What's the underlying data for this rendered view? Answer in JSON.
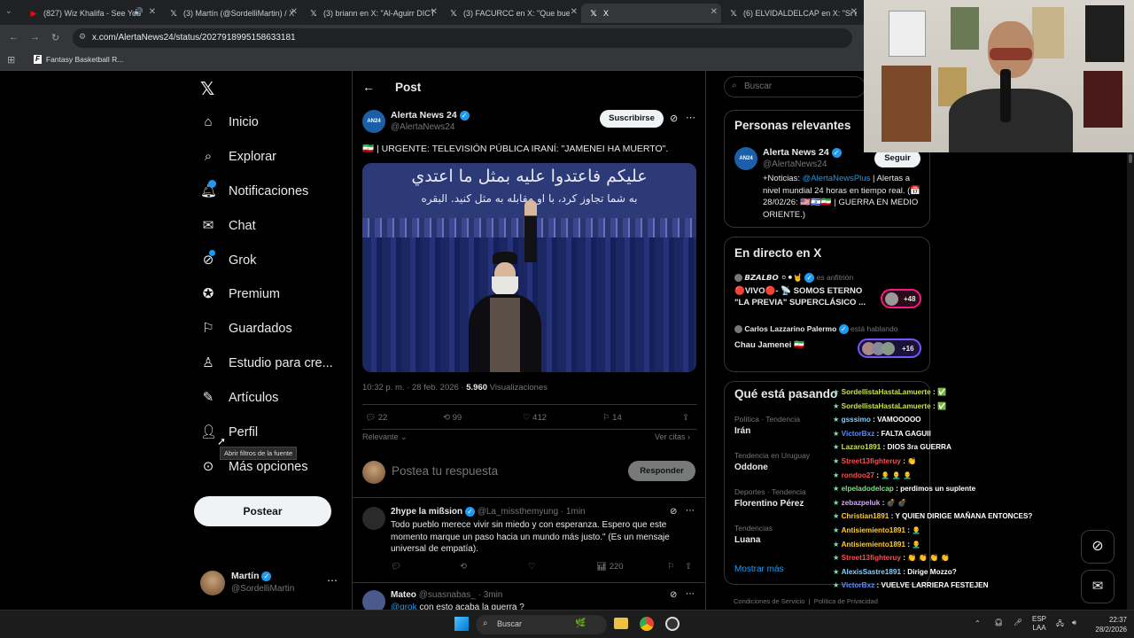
{
  "browser": {
    "tabs": [
      {
        "icon": "youtube-icon",
        "label": "(827) Wiz Khalifa - See You"
      },
      {
        "icon": "x-logo-icon",
        "label": "(3) Martín (@SordelliMartin) / X"
      },
      {
        "icon": "x-logo-icon",
        "label": "(3) briann en X: \"Al-Aguirr DICT"
      },
      {
        "icon": "x-logo-icon",
        "label": "(3) FACURCC en X: \"Que buen"
      },
      {
        "icon": "x-logo-icon",
        "label": "X"
      },
      {
        "icon": "x-logo-icon",
        "label": "(6) ELVIDALDELCAP en X: \"Si en"
      }
    ],
    "url": "x.com/AlertaNews24/status/2027918995158633181",
    "bookmark": "Fantasy Basketball R..."
  },
  "sidebar": {
    "items": [
      {
        "label": "Inicio",
        "icon": "home-icon"
      },
      {
        "label": "Explorar",
        "icon": "search-icon"
      },
      {
        "label": "Notificaciones",
        "icon": "bell-icon"
      },
      {
        "label": "Chat",
        "icon": "mail-icon"
      },
      {
        "label": "Grok",
        "icon": "grok-icon"
      },
      {
        "label": "Premium",
        "icon": "verified-icon"
      },
      {
        "label": "Guardados",
        "icon": "bookmark-icon"
      },
      {
        "label": "Estudio para cre...",
        "icon": "studio-icon"
      },
      {
        "label": "Artículos",
        "icon": "article-icon"
      },
      {
        "label": "Perfil",
        "icon": "person-icon"
      },
      {
        "label": "Más opciones",
        "icon": "more-icon"
      }
    ],
    "tooltip": "Abrir filtros de la fuente",
    "post_button": "Postear",
    "account": {
      "name": "Martín",
      "handle": "@SordelliMartin"
    }
  },
  "post": {
    "header": "Post",
    "author": "Alerta News 24",
    "handle": "@AlertaNews24",
    "subscribe": "Suscribirse",
    "text": "🇮🇷 | URGENTE: TELEVISIÓN PÚBLICA IRANÍ: \"JAMENEI HA MUERTO\".",
    "image_text_1": "عليكم فاعتدوا عليه بمثل ما اعتدي",
    "image_text_2": "به شما تجاوز كرد، با او مقابله به مثل كنيد. البقره",
    "time": "10:32 p. m. · 28 feb. 2026 ·",
    "views_count": "5.960",
    "views_label": "Visualizaciones",
    "replies": "22",
    "reposts": "99",
    "likes": "412",
    "bookmarks": "14",
    "relevant": "Relevante",
    "quotes": "Ver citas",
    "reply_placeholder": "Postea tu respuesta",
    "reply_button": "Responder"
  },
  "replies": [
    {
      "name": "2hype la mißsion",
      "handle": "@La_missthemyung",
      "time": "1min",
      "text": "Todo pueblo merece vivir sin miedo y con esperanza. Espero que este momento marque un paso hacia un mundo más justo.\" (Es un mensaje universal de empatía).",
      "views": "220"
    },
    {
      "name": "Mateo",
      "handle": "@suasnabas_",
      "time": "3min",
      "mention": "@grok",
      "text": "con esto acaba la guerra ?"
    }
  ],
  "right": {
    "search_placeholder": "Buscar",
    "relevant_title": "Personas relevantes",
    "person": {
      "name": "Alerta News 24",
      "handle": "@AlertaNews24",
      "follow": "Seguir",
      "bio_1": "+Noticias: ",
      "bio_link": "@AlertaNewsPlus",
      "bio_2": " | Alertas a nivel mundial 24 horas en tiempo real. (📅 28/02/26: 🇺🇸🇮🇱🇮🇷 | GUERRA EN MEDIO ORIENTE.)"
    },
    "live_title": "En directo en X",
    "live": [
      {
        "host": "𝘽𝙕𝘼𝙇𝘽𝙊 ⚪⚫🤘",
        "role": "es anfitrión",
        "title": "🔴VIVO🔴- 📡 SOMOS ETERNO \"LA PREVIA\" SUPERCLÁSICO ...",
        "count": "+48"
      },
      {
        "host": "Carlos Lazzarino Palermo",
        "role": "está hablando",
        "title": "Chau Jamenei 🇮🇷",
        "count": "+16"
      }
    ],
    "trends_title": "Qué está pasando",
    "trends": [
      {
        "context": "Política · Tendencia",
        "name": "Irán"
      },
      {
        "context": "Tendencia en Uruguay",
        "name": "Oddone"
      },
      {
        "context": "Deportes · Tendencia",
        "name": "Florentino Pérez"
      },
      {
        "context": "Tendencias",
        "name": "Luana"
      }
    ],
    "show_more": "Mostrar más",
    "footer": "Condiciones de Servicio  |  Política de Privacidad"
  },
  "chat": [
    {
      "user": "SordellistaHastaLamuerte",
      "msg": ": ✅",
      "color": "#c9e04b"
    },
    {
      "user": "SordellistaHastaLamuerte",
      "msg": ": ✅",
      "color": "#c9e04b"
    },
    {
      "user": "gsssimo",
      "msg": ": VAMOOOOO",
      "color": "#7fd1ff"
    },
    {
      "user": "VictorBxz",
      "msg": ": FALTA GAGUII",
      "color": "#5a8dff"
    },
    {
      "user": "Lazaro1891",
      "msg": ": DIOS 3ra GUERRA",
      "color": "#c9e04b"
    },
    {
      "user": "Street13fighteruy",
      "msg": ": 👏",
      "color": "#ff4d4d"
    },
    {
      "user": "rondoo27",
      "msg": ": 👨‍🦲 👨‍🦲 👨‍🦲",
      "color": "#ff4d4d"
    },
    {
      "user": "elpeladodelcap",
      "msg": ": perdimos un suplente",
      "color": "#7fe07f"
    },
    {
      "user": "zebazpeluk",
      "msg": ": 💣 💣",
      "color": "#d7a6ff"
    },
    {
      "user": "Christian1891",
      "msg": ": Y QUIEN DIRIGE MAÑANA ENTONCES?",
      "color": "#ffcc33"
    },
    {
      "user": "Antisiemiento1891",
      "msg": ": 👨‍🦲",
      "color": "#ffcc33"
    },
    {
      "user": "Antisiemiento1891",
      "msg": ": 👨‍🦲",
      "color": "#ffcc33"
    },
    {
      "user": "Street13fighteruy",
      "msg": ": 👏 👏 👏 👏",
      "color": "#ff4d4d"
    },
    {
      "user": "AlexisSastre1891",
      "msg": ": Dirige Mozzo?",
      "color": "#7fd1ff"
    },
    {
      "user": "VictorBxz",
      "msg": ": VUELVE LARRIERA FESTEJEN",
      "color": "#5a8dff"
    }
  ],
  "taskbar": {
    "search": "Buscar",
    "lang_1": "ESP",
    "lang_2": "LAA",
    "time": "22:37",
    "date": "28/2/2026"
  },
  "colors": {
    "accent": "#1d9bf0",
    "bg": "#000000",
    "border": "#2f3336",
    "muted": "#71767b"
  }
}
